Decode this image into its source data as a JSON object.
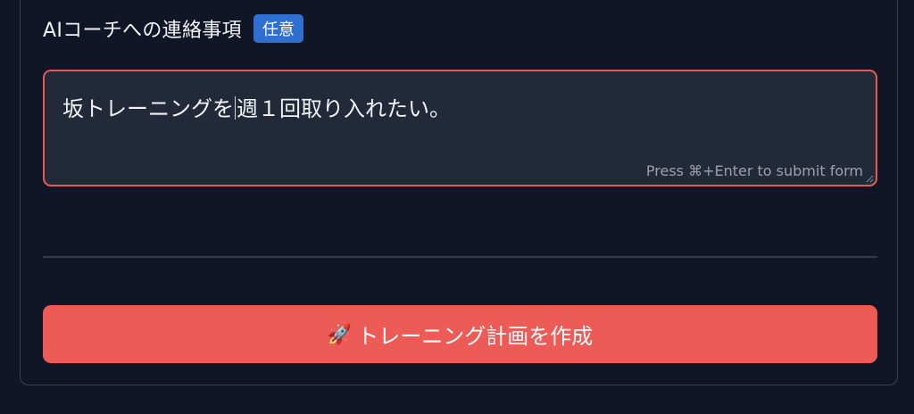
{
  "form": {
    "coach_note_label": "AIコーチへの連絡事項",
    "optional_badge": "任意",
    "textarea": {
      "value_before_cursor": "坂トレーニングを",
      "value_after_cursor": "週１回取り入れたい。",
      "submit_hint": "Press ⌘+Enter to submit form"
    },
    "submit_button": {
      "icon": "rocket-icon",
      "icon_glyph": "🚀",
      "label": "トレーニング計画を作成"
    }
  },
  "colors": {
    "background": "#111627",
    "textarea_border_focus": "#e45c57",
    "badge": "#2f6fd0",
    "button": "#ec5b55"
  }
}
